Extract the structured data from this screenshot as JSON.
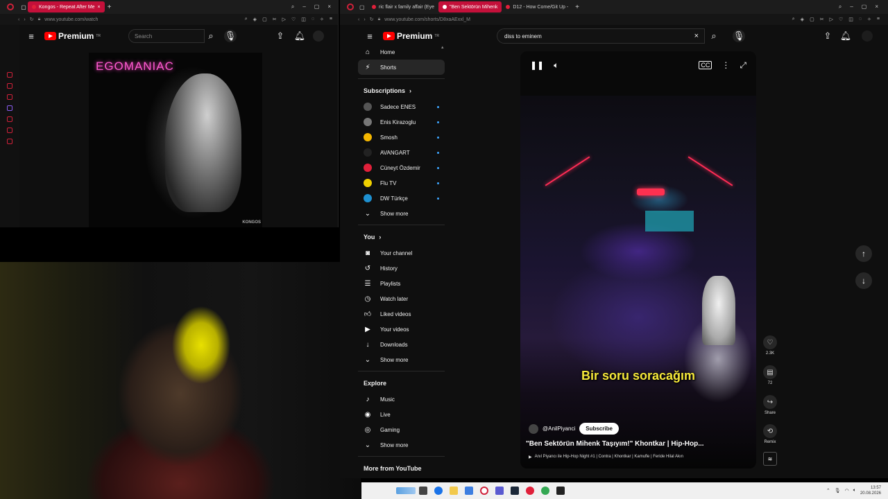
{
  "left_browser": {
    "tab_title": "Kongos - Repeat After Me",
    "url": "www.youtube.com/watch",
    "logo_text": "Premium",
    "logo_sup": "TR",
    "search_placeholder": "Search",
    "thumbnail_title": "EGOMANIAC",
    "thumbnail_brand": "KONGOS"
  },
  "right_browser": {
    "tabs": [
      {
        "label": "ric flair x family affair (Eye"
      },
      {
        "label": "\"Ben Sektörün Mihenk"
      },
      {
        "label": "D12 - How Come/Git Up - "
      }
    ],
    "url": "www.youtube.com/shorts/D8xaAExxl_M",
    "logo_text": "Premium",
    "logo_sup": "TR",
    "search_value": "diss to eminem"
  },
  "sidebar": {
    "main": [
      {
        "label": "Home",
        "icon": "home-icon"
      },
      {
        "label": "Shorts",
        "icon": "shorts-icon"
      }
    ],
    "subscriptions_title": "Subscriptions",
    "subscriptions": [
      {
        "label": "Sadece ENES",
        "color": "#555555"
      },
      {
        "label": "Enis Kirazoglu",
        "color": "#777777"
      },
      {
        "label": "Smosh",
        "color": "#f5b700"
      },
      {
        "label": "AVANGART",
        "color": "#222222"
      },
      {
        "label": "Cüneyt Özdemir",
        "color": "#e0203a"
      },
      {
        "label": "Flu TV",
        "color": "#f0d000"
      },
      {
        "label": "DW Türkçe",
        "color": "#1e90d0"
      }
    ],
    "subs_show_more": "Show more",
    "you_title": "You",
    "you": [
      {
        "label": "Your channel",
        "icon": "channel-icon"
      },
      {
        "label": "History",
        "icon": "history-icon"
      },
      {
        "label": "Playlists",
        "icon": "playlist-icon"
      },
      {
        "label": "Watch later",
        "icon": "clock-icon"
      },
      {
        "label": "Liked videos",
        "icon": "thumb-up-icon"
      },
      {
        "label": "Your videos",
        "icon": "video-icon"
      },
      {
        "label": "Downloads",
        "icon": "download-icon"
      }
    ],
    "you_show_more": "Show more",
    "explore_title": "Explore",
    "explore": [
      {
        "label": "Music",
        "icon": "music-icon"
      },
      {
        "label": "Live",
        "icon": "live-icon"
      },
      {
        "label": "Gaming",
        "icon": "gaming-icon"
      }
    ],
    "explore_show_more": "Show more",
    "more_title": "More from YouTube"
  },
  "short": {
    "subtitle": "Bir soru soracağım",
    "channel": "@AnilPiyanci",
    "subscribe": "Subscribe",
    "title": "\"Ben Sektörün Mihenk Taşıyım!\" Khontkar | Hip-Hop...",
    "playlist": "Anıl Piyancı ile Hip-Hop Night #1 | Contra | Khontkar | Kamufle | Feride Hilal Akın"
  },
  "actions": {
    "likes": "2.3K",
    "comments": "72",
    "share": "Share",
    "remix": "Remix"
  },
  "taskbar": {
    "time": "13:57",
    "date": "20.08.2026"
  }
}
